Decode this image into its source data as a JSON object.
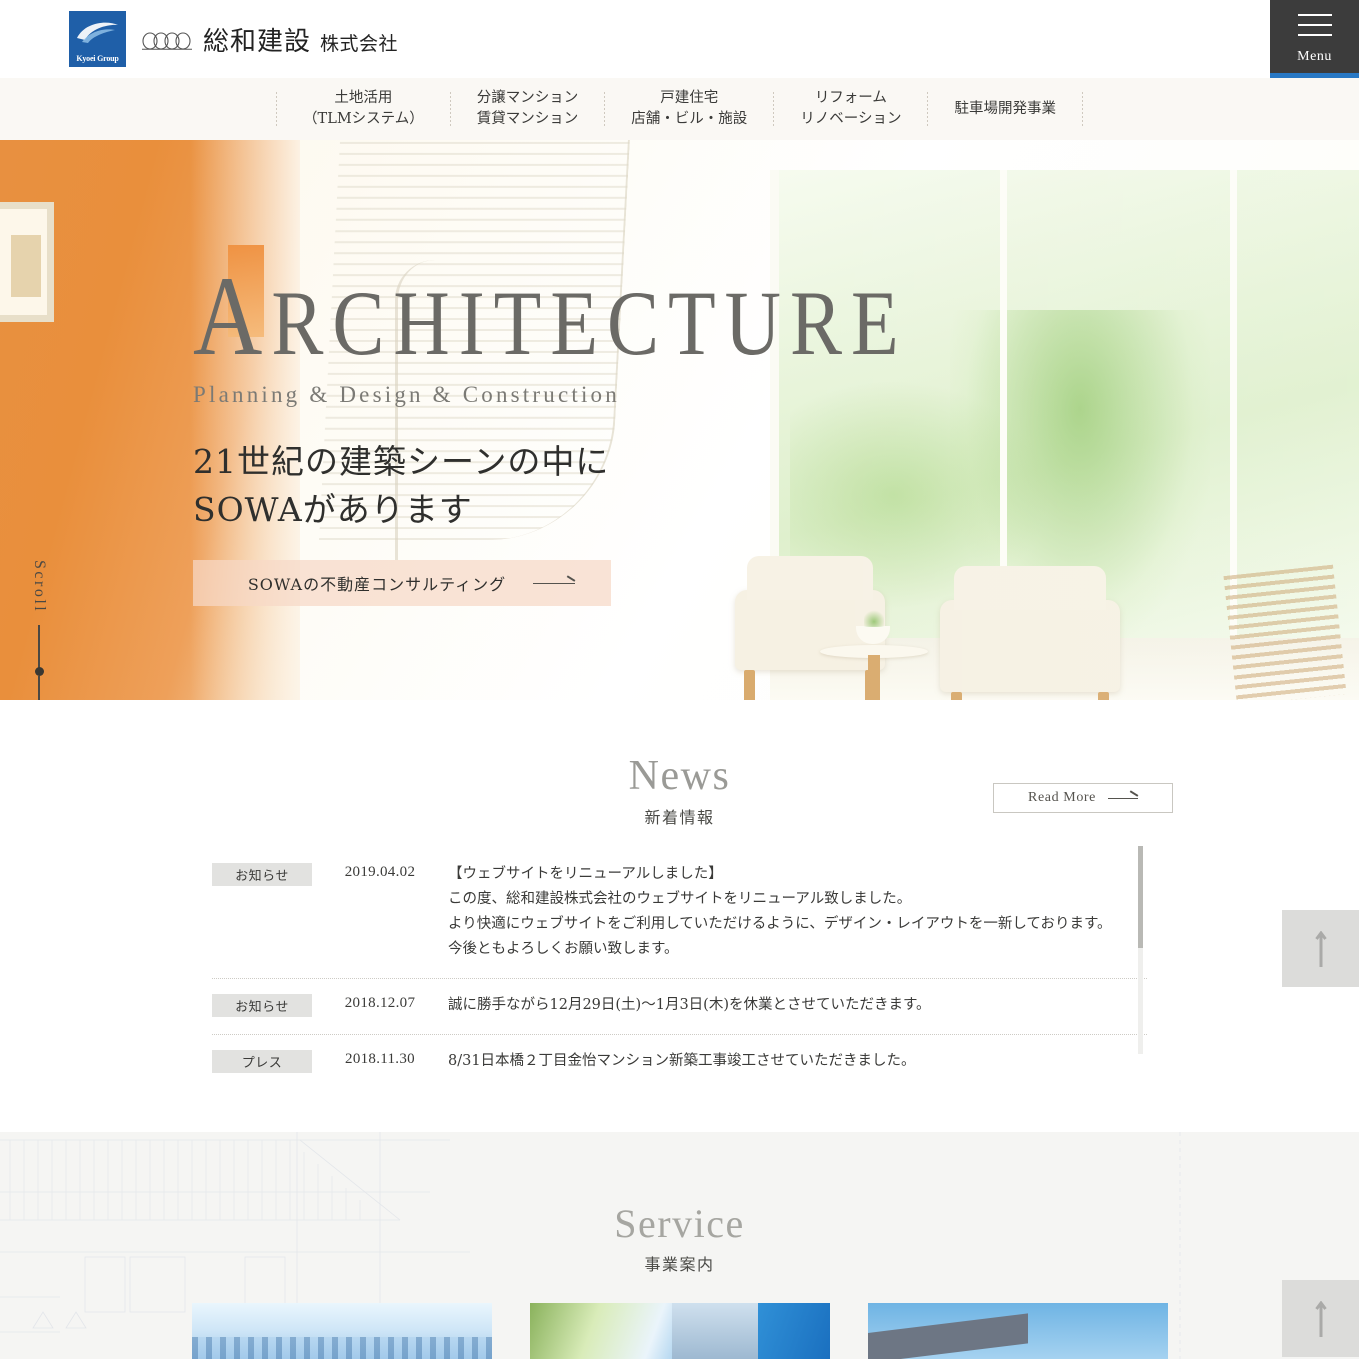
{
  "header": {
    "logo": {
      "group_label": "Kyoei Group",
      "icon": "kyoei-swoosh-icon"
    },
    "company_main": "総和建設",
    "company_sub": "株式会社",
    "menu_label": "Menu"
  },
  "nav": {
    "items": [
      {
        "line1": "土地活用",
        "line2": "（TLMシステム）"
      },
      {
        "line1": "分譲マンション",
        "line2": "賃貸マンション"
      },
      {
        "line1": "戸建住宅",
        "line2": "店舗・ビル・施設"
      },
      {
        "line1": "リフォーム",
        "line2": "リノベーション"
      },
      {
        "line1": "駐車場開発事業",
        "line2": ""
      }
    ]
  },
  "hero": {
    "title": "ARCHITECTURE",
    "title_cap": "A",
    "title_rest": "RCHITECTURE",
    "subtitle": "Planning & Design & Construction",
    "catch_line1": "21世紀の建築シーンの中に",
    "catch_line2": "SOWAがあります",
    "cta_label": "SOWAの不動産コンサルティング",
    "scroll_label": "Scroll"
  },
  "news": {
    "heading_en": "News",
    "heading_jp": "新着情報",
    "read_more": "Read More",
    "items": [
      {
        "category": "お知らせ",
        "date": "2019.04.02",
        "lines": [
          "【ウェブサイトをリニューアルしました】",
          "この度、総和建設株式会社のウェブサイトをリニューアル致しました。",
          "より快適にウェブサイトをご利用していただけるように、デザイン・レイアウトを一新しております。",
          "今後ともよろしくお願い致します。"
        ]
      },
      {
        "category": "お知らせ",
        "date": "2018.12.07",
        "lines": [
          "誠に勝手ながら12月29日(土)〜1月3日(木)を休業とさせていただきます。"
        ]
      },
      {
        "category": "プレス",
        "date": "2018.11.30",
        "lines": [
          "8/31日本橋２丁目金怡マンション新築工事竣工させていただきました。"
        ]
      }
    ]
  },
  "service": {
    "heading_en": "Service",
    "heading_jp": "事業案内",
    "cards": [
      {
        "image_alt": "city-skyline-photo"
      },
      {
        "image_alt": "building-with-tree-photo"
      },
      {
        "image_alt": "house-roof-blue-sky-photo"
      }
    ]
  },
  "back_to_top": {
    "label": "↑",
    "icon": "arrow-up-icon"
  },
  "colors": {
    "brand_blue": "#1f5fa8",
    "menu_accent": "#2878c4",
    "nav_bg": "#faf8f4",
    "badge_bg": "#e2e2e0",
    "cta_bg": "#f7d8c6",
    "service_bg": "#f5f5f3"
  }
}
